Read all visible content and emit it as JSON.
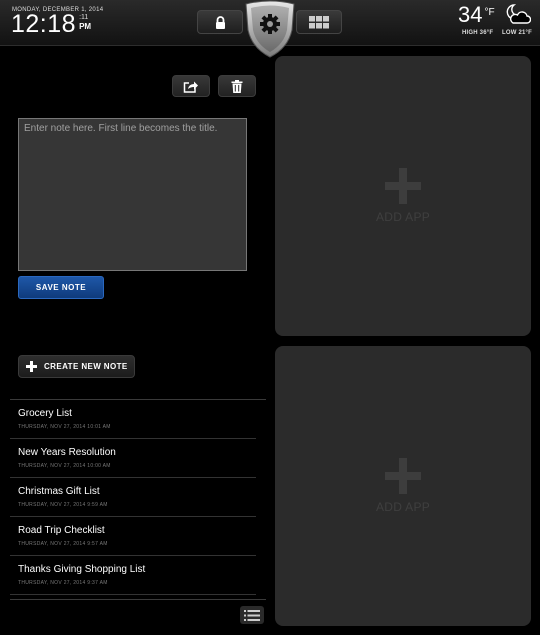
{
  "status_bar": {
    "date": "MONDAY, DECEMBER 1, 2014",
    "time": "12:18",
    "seconds": ":11",
    "ampm": "PM"
  },
  "toolbar": {
    "lock_icon": "lock-icon",
    "settings_icon": "gear-icon",
    "apps_icon": "grid-icon"
  },
  "weather": {
    "temperature": "34",
    "unit": "°F",
    "high": "HIGH 36°F",
    "low": "LOW 21°F",
    "icon": "partly-cloudy-night-icon"
  },
  "editor": {
    "placeholder": "Enter note here. First line becomes the title.",
    "value": "",
    "save_label": "SAVE NOTE",
    "share_icon": "share-icon",
    "trash_icon": "trash-icon"
  },
  "create_note": {
    "label": "CREATE NEW NOTE"
  },
  "notes": [
    {
      "title": "Grocery List",
      "timestamp": "THURSDAY, NOV 27, 2014 10:01 AM"
    },
    {
      "title": "New Years Resolution",
      "timestamp": "THURSDAY, NOV 27, 2014 10:00 AM"
    },
    {
      "title": "Christmas Gift List",
      "timestamp": "THURSDAY, NOV 27, 2014 9:59 AM"
    },
    {
      "title": "Road Trip Checklist",
      "timestamp": "THURSDAY, NOV 27, 2014 9:57 AM"
    },
    {
      "title": "Thanks Giving Shopping List",
      "timestamp": "THURSDAY, NOV 27, 2014 9:37 AM"
    }
  ],
  "app_panels": [
    {
      "label": "ADD APP"
    },
    {
      "label": "ADD APP"
    }
  ],
  "colors": {
    "accent_blue": "#1e57a8",
    "panel_bg": "#2b2b2b",
    "background": "#000000"
  }
}
